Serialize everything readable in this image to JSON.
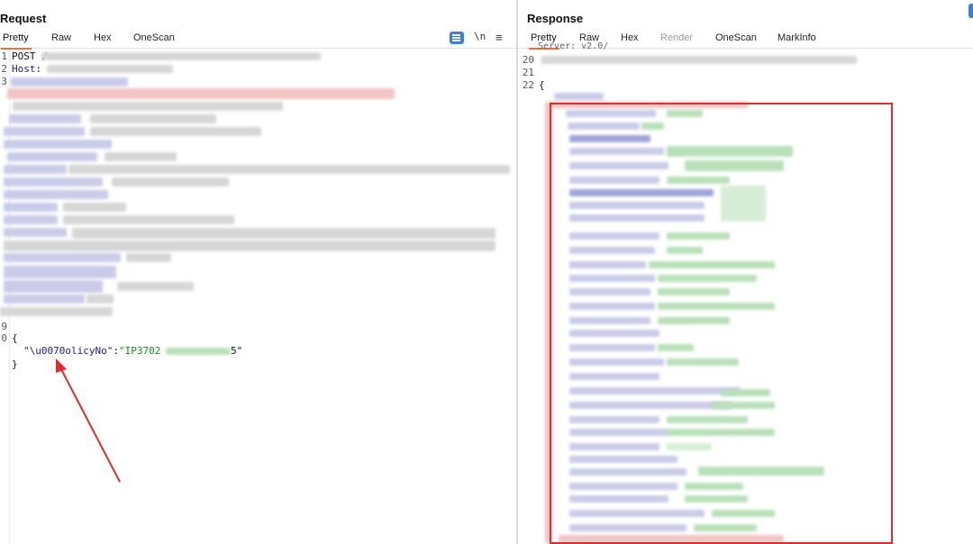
{
  "request": {
    "title": "Request",
    "tabs": [
      {
        "label": "Pretty",
        "active": true
      },
      {
        "label": "Raw",
        "active": false
      },
      {
        "label": "Hex",
        "active": false
      },
      {
        "label": "OneScan",
        "active": false
      }
    ],
    "tools": {
      "wrap_icon": "wrap-lines-icon",
      "newline_label": "\\n",
      "menu_label": "≡"
    },
    "lines": [
      {
        "num": "1",
        "text": "POST /"
      },
      {
        "num": "2",
        "text": "Host:"
      },
      {
        "num": "3",
        "text": ""
      },
      {
        "num": "9",
        "text": ""
      },
      {
        "num": "0",
        "text": "{"
      },
      {
        "num": "",
        "text": "}"
      }
    ],
    "body": {
      "key": "\"\\u0070olicyNo\"",
      "colon": ":",
      "value_start": "\"IP3702",
      "value_end": "5\""
    }
  },
  "response": {
    "title": "Response",
    "tabs": [
      {
        "label": "Pretty",
        "active": true
      },
      {
        "label": "Raw",
        "active": false
      },
      {
        "label": "Hex",
        "active": false
      },
      {
        "label": "Render",
        "active": false,
        "disabled": true
      },
      {
        "label": "OneScan",
        "active": false
      },
      {
        "label": "MarkInfo",
        "active": false
      }
    ],
    "lines": [
      {
        "num": "20",
        "text": ""
      },
      {
        "num": "21",
        "text": ""
      },
      {
        "num": "22",
        "text": "{"
      }
    ],
    "partial_top_text": "Server: v2.0/"
  },
  "colors": {
    "accent_tab": "#e8743b",
    "annotation_red": "#e02d2d",
    "json_key": "#1a1a8c",
    "json_string": "#1e8a1e"
  }
}
